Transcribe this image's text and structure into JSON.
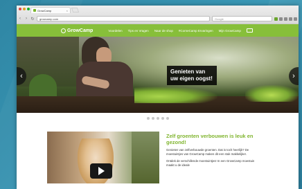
{
  "browser": {
    "tab_title": "GrowCamp",
    "url": "growcamp.com",
    "search_placeholder": "Google",
    "close_glyph": "×",
    "back_glyph": "‹",
    "forward_glyph": "›",
    "reload_glyph": "↻"
  },
  "nav": {
    "logo_text": "GrowCamp",
    "items": [
      {
        "label": "Voordelen"
      },
      {
        "label": "Tips en Vragen"
      },
      {
        "label": "Naar de shop"
      },
      {
        "label": "#CorneCamp Ervaringen"
      },
      {
        "label": "Mijn GrowCamp"
      }
    ],
    "cart_icon": "cart-icon"
  },
  "hero": {
    "caption": "Genieten van uw eigen oogst!",
    "prev_glyph": "‹",
    "next_glyph": "›",
    "slide_count": 5,
    "active_slide": 1
  },
  "content": {
    "heading": "Zelf groenten verbouwen is leuk en gezond!",
    "para1": "Genieten van zelfverbouwde groenten. Dat is toch heerlijk? De moestuintjes van GrowCamp maken dit een stuk makkelijker.",
    "para2": "Ontdek de verschillende moestuintjes! In een GrowCamp moestuin maakt u de ideale"
  },
  "colors": {
    "brand_green": "#87bf3a",
    "heading_green": "#80b52f"
  }
}
